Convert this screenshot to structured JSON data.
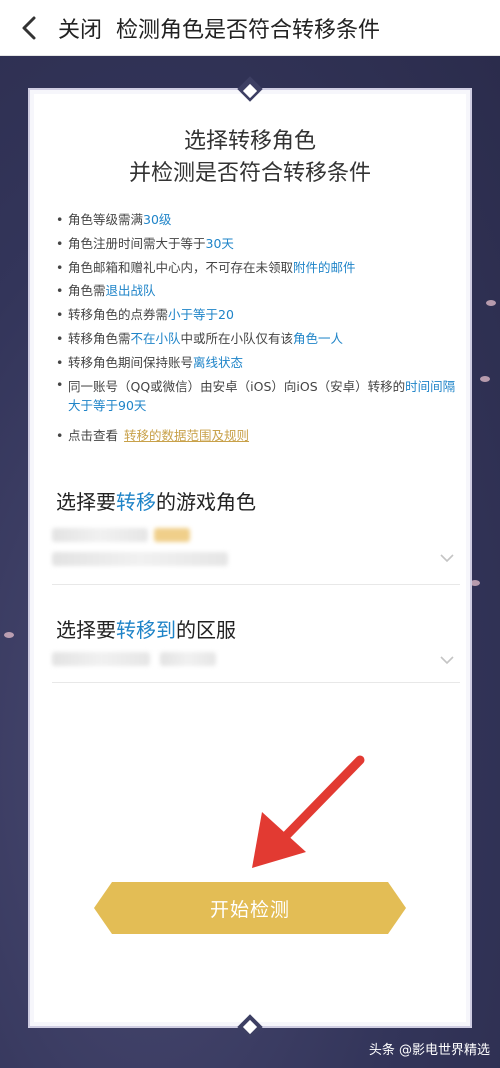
{
  "topbar": {
    "close_label": "关闭",
    "title": "检测角色是否符合转移条件"
  },
  "card": {
    "headline_line1": "选择转移角色",
    "headline_line2": "并检测是否符合转移条件",
    "rules": [
      [
        {
          "t": "角色等级需满"
        },
        {
          "t": "30级",
          "hl": true
        }
      ],
      [
        {
          "t": "角色注册时间需大于等于"
        },
        {
          "t": "30天",
          "hl": true
        }
      ],
      [
        {
          "t": "角色邮箱和赠礼中心内，不可存在未领取"
        },
        {
          "t": "附件的邮件",
          "hl": true
        }
      ],
      [
        {
          "t": "角色需"
        },
        {
          "t": "退出战队",
          "hl": true
        }
      ],
      [
        {
          "t": "转移角色的点券需"
        },
        {
          "t": "小于等于20",
          "hl": true
        }
      ],
      [
        {
          "t": "转移角色需"
        },
        {
          "t": "不在小队",
          "hl": true
        },
        {
          "t": "中或所在小队仅有该"
        },
        {
          "t": "角色一人",
          "hl": true
        }
      ],
      [
        {
          "t": "转移角色期间保持账号"
        },
        {
          "t": "离线状态",
          "hl": true
        }
      ],
      [
        {
          "t": "同一账号（QQ或微信）由安卓（iOS）向iOS（安卓）转移的"
        },
        {
          "t": "时间间隔大于等于90天",
          "hl": true
        }
      ]
    ],
    "view_prefix": "点击查看",
    "view_link": "转移的数据范围及规则"
  },
  "role_section": {
    "title_pre": "选择要",
    "title_hl": "转移",
    "title_post": "的游戏角色"
  },
  "server_section": {
    "title_pre": "选择要",
    "title_hl": "转移到",
    "title_post": "的区服"
  },
  "start_button": "开始检测",
  "watermark": "头条 @影电世界精选",
  "colors": {
    "highlight": "#1f84c8",
    "button": "#e3bd55",
    "link": "#c8a14a",
    "arrow": "#e23a32",
    "background": "#3d3f63"
  },
  "icons": [
    "back-icon",
    "chevron-down-icon",
    "red-arrow-icon"
  ]
}
